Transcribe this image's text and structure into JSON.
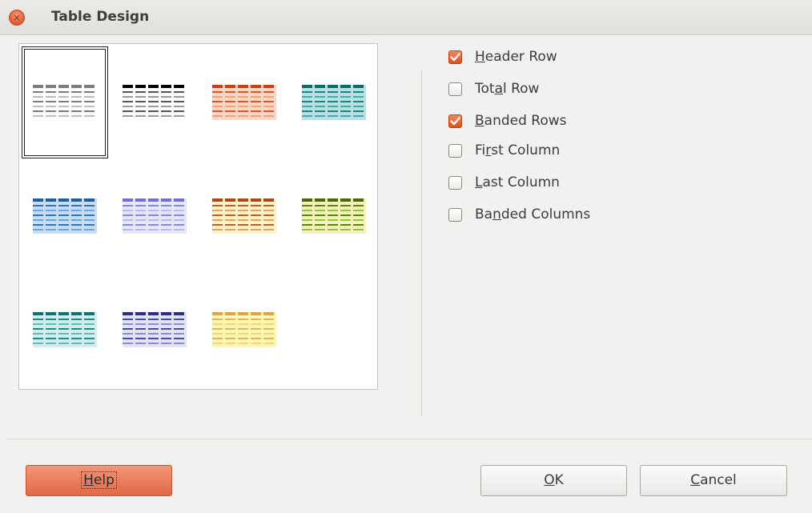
{
  "window": {
    "title": "Table Design",
    "close_glyph": "×"
  },
  "styles": [
    {
      "name": "default",
      "header": "#7c7c7c",
      "dark": "#7c7c7c",
      "light": "#bdbdbd",
      "fill": "#ffffff",
      "selected": true
    },
    {
      "name": "black-header",
      "header": "#000000",
      "dark": "#555555",
      "light": "#9a9a9a",
      "fill": "#ffffff",
      "selected": false
    },
    {
      "name": "orange",
      "header": "#d03e10",
      "dark": "#d9542b",
      "light": "#f0a27f",
      "fill": "#fbd5c3",
      "selected": false
    },
    {
      "name": "teal",
      "header": "#0b6b6b",
      "dark": "#138585",
      "light": "#44a9a9",
      "fill": "#b9e1e1",
      "selected": false
    },
    {
      "name": "blue",
      "header": "#1e5ea8",
      "dark": "#2f72c0",
      "light": "#6da3df",
      "fill": "#c7ddf5",
      "selected": false
    },
    {
      "name": "lavender",
      "header": "#6f6fd6",
      "dark": "#8787e2",
      "light": "#b8b8f0",
      "fill": "#e6e6fb",
      "selected": false
    },
    {
      "name": "rust-yellow",
      "header": "#b04616",
      "dark": "#c65a24",
      "light": "#e4a068",
      "fill": "#fdf2c4",
      "selected": false
    },
    {
      "name": "olive",
      "header": "#44680c",
      "dark": "#5a8418",
      "light": "#9bbf44",
      "fill": "#f3f3b8",
      "selected": false
    },
    {
      "name": "sea-green",
      "header": "#117070",
      "dark": "#1b8a8a",
      "light": "#5fbcbc",
      "fill": "#d0eeee",
      "selected": false
    },
    {
      "name": "indigo",
      "header": "#2e2e8a",
      "dark": "#4a4aa6",
      "light": "#8d8dd0",
      "fill": "#e3e3f6",
      "selected": false
    },
    {
      "name": "gold",
      "header": "#d9a255",
      "dark": "#e3b06b",
      "light": "#f0d48c",
      "fill": "#fdf7a8",
      "selected": false
    }
  ],
  "options": [
    {
      "id": "header-row",
      "pre": "",
      "ul": "H",
      "post": "eader Row",
      "checked": true
    },
    {
      "id": "total-row",
      "pre": "Tot",
      "ul": "a",
      "post": "l Row",
      "checked": false
    },
    {
      "id": "banded-rows",
      "pre": "",
      "ul": "B",
      "post": "anded Rows",
      "checked": true
    },
    {
      "id": "first-column",
      "pre": "Fi",
      "ul": "r",
      "post": "st Column",
      "checked": false
    },
    {
      "id": "last-column",
      "pre": "",
      "ul": "L",
      "post": "ast Column",
      "checked": false
    },
    {
      "id": "banded-columns",
      "pre": "Ba",
      "ul": "n",
      "post": "ded Columns",
      "checked": false
    }
  ],
  "buttons": {
    "help": {
      "ul": "H",
      "rest": "elp"
    },
    "ok": {
      "ul": "O",
      "rest": "K"
    },
    "cancel": {
      "ul": "C",
      "rest": "ancel"
    }
  },
  "colors": {
    "accent": "#e0592a",
    "dialog_bg": "#f2f1f0"
  }
}
